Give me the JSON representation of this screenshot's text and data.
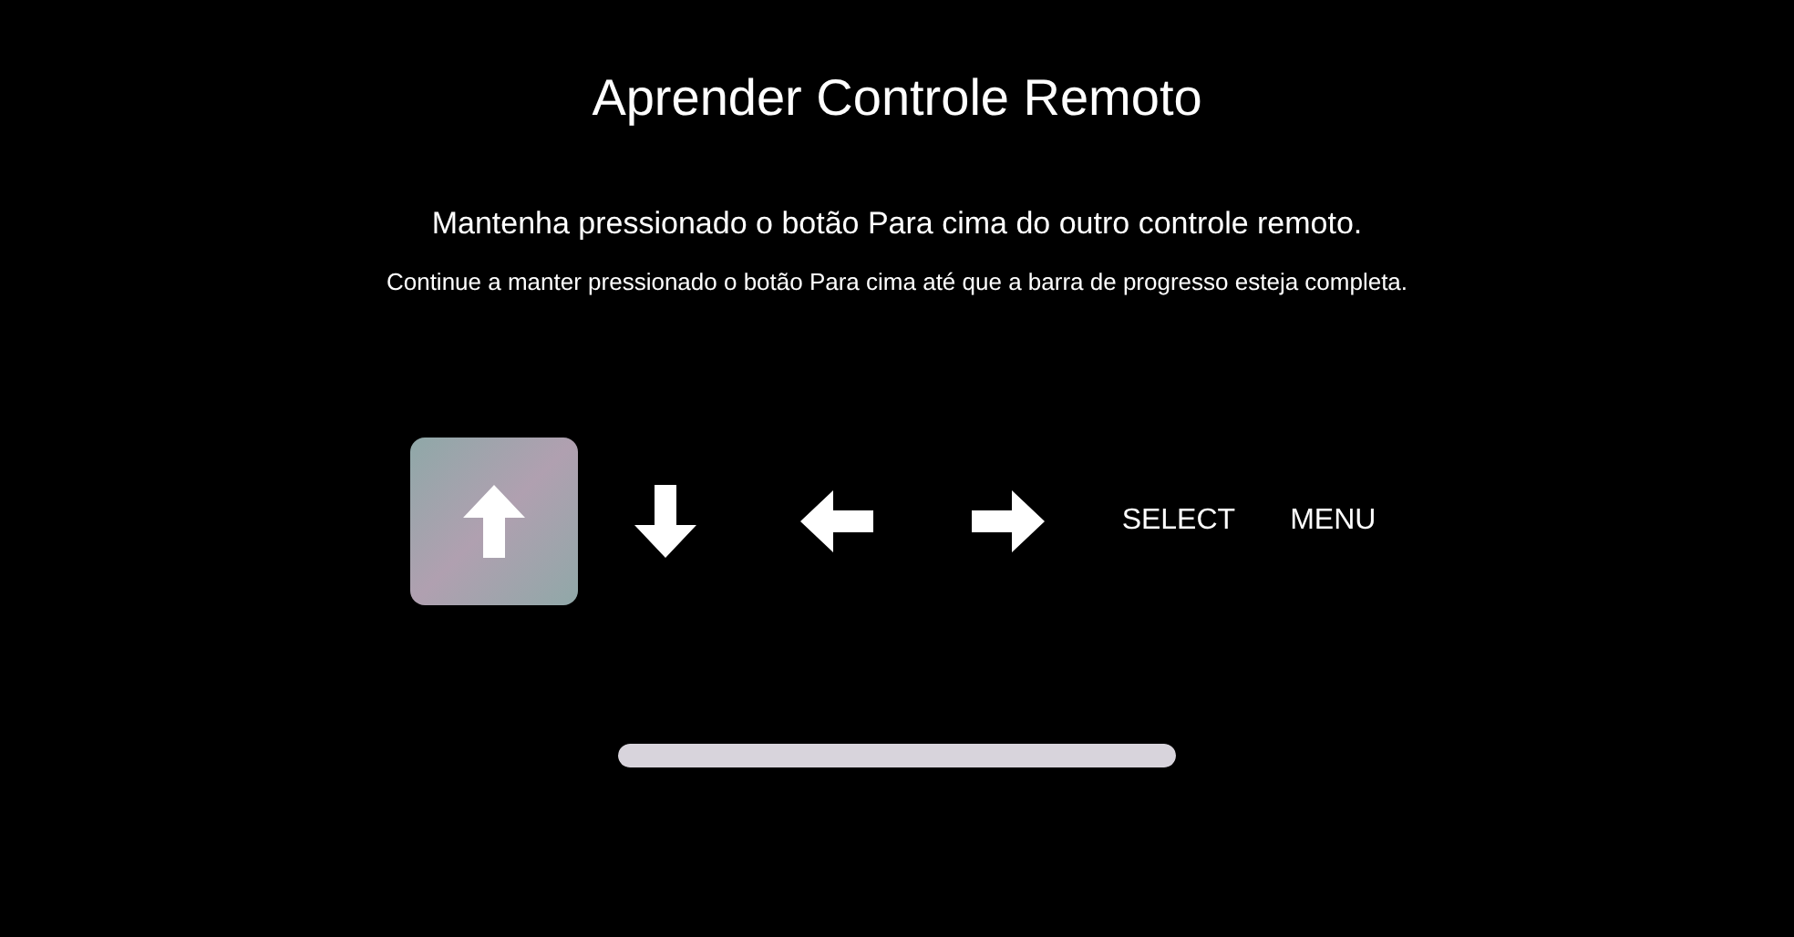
{
  "title": "Aprender Controle Remoto",
  "instruction": "Mantenha pressionado o botão Para cima do outro controle remoto.",
  "hint": "Continue a manter pressionado o botão Para cima até que a barra de progresso esteja completa.",
  "buttons": [
    {
      "kind": "up",
      "selected": true
    },
    {
      "kind": "down",
      "selected": false
    },
    {
      "kind": "left",
      "selected": false
    },
    {
      "kind": "right",
      "selected": false
    },
    {
      "kind": "text",
      "label": "SELECT",
      "selected": false
    },
    {
      "kind": "text",
      "label": "MENU",
      "selected": false
    }
  ],
  "progress": {
    "level": 1
  }
}
